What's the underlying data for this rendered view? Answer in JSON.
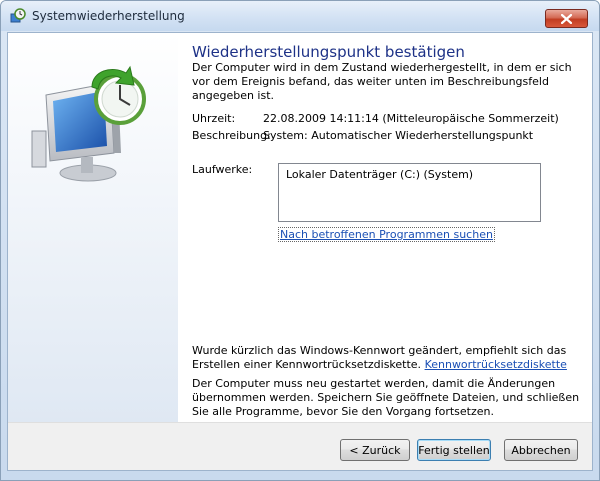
{
  "window": {
    "title": "Systemwiederherstellung",
    "close_icon": "close-icon"
  },
  "main": {
    "heading": "Wiederherstellungspunkt bestätigen",
    "intro": "Der Computer wird in dem Zustand wiederhergestellt, in dem er sich vor dem Ereignis befand, das weiter unten im Beschreibungsfeld angegeben ist.",
    "time_label": "Uhrzeit:",
    "time_value": "22.08.2009 14:11:14 (Mitteleuropäische Sommerzeit)",
    "description_label": "Beschreibung:",
    "description_value": "System: Automatischer Wiederherstellungspunkt",
    "drives_label": "Laufwerke:",
    "drives": [
      "Lokaler Datenträger (C:) (System)"
    ],
    "affected_programs_link": "Nach betroffenen Programmen suchen",
    "password_notice": "Wurde kürzlich das Windows-Kennwort geändert, empfiehlt sich das Erstellen einer Kennwortrücksetzdiskette.",
    "password_reset_link": "Kennwortrücksetzdiskette",
    "restart_notice": "Der Computer muss neu gestartet werden, damit die Änderungen übernommen werden. Speichern Sie geöffnete Dateien, und schließen Sie alle Programme, bevor Sie den Vorgang fortsetzen."
  },
  "footer": {
    "back_label": "< Zurück",
    "finish_label": "Fertig stellen",
    "cancel_label": "Abbrechen"
  },
  "colors": {
    "heading": "#1e3287",
    "link": "#1a4fb4",
    "close_button": "#c13d22"
  }
}
